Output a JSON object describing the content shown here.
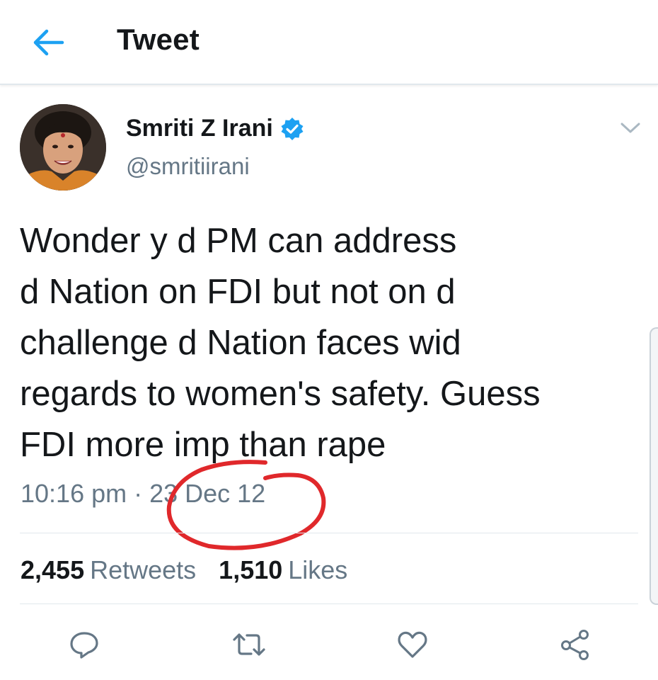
{
  "header": {
    "title": "Tweet",
    "back_icon": "arrow-left-icon"
  },
  "author": {
    "display_name": "Smriti Z Irani",
    "handle": "@smritiirani",
    "verified": true
  },
  "tweet": {
    "text": "Wonder y d PM can address\nd Nation on FDI but not on d\nchallenge d Nation faces wid\nregards to women's safety. Guess\nFDI more imp than rape",
    "timestamp": "10:16 pm · 23 Dec 12"
  },
  "stats": {
    "retweets_count": "2,455",
    "retweets_label": "Retweets",
    "likes_count": "1,510",
    "likes_label": "Likes"
  },
  "actions": [
    "reply-icon",
    "retweet-icon",
    "like-icon",
    "share-icon"
  ],
  "colors": {
    "accent": "#1da1f2",
    "secondary_text": "#657786",
    "annotation": "#e0282b"
  }
}
